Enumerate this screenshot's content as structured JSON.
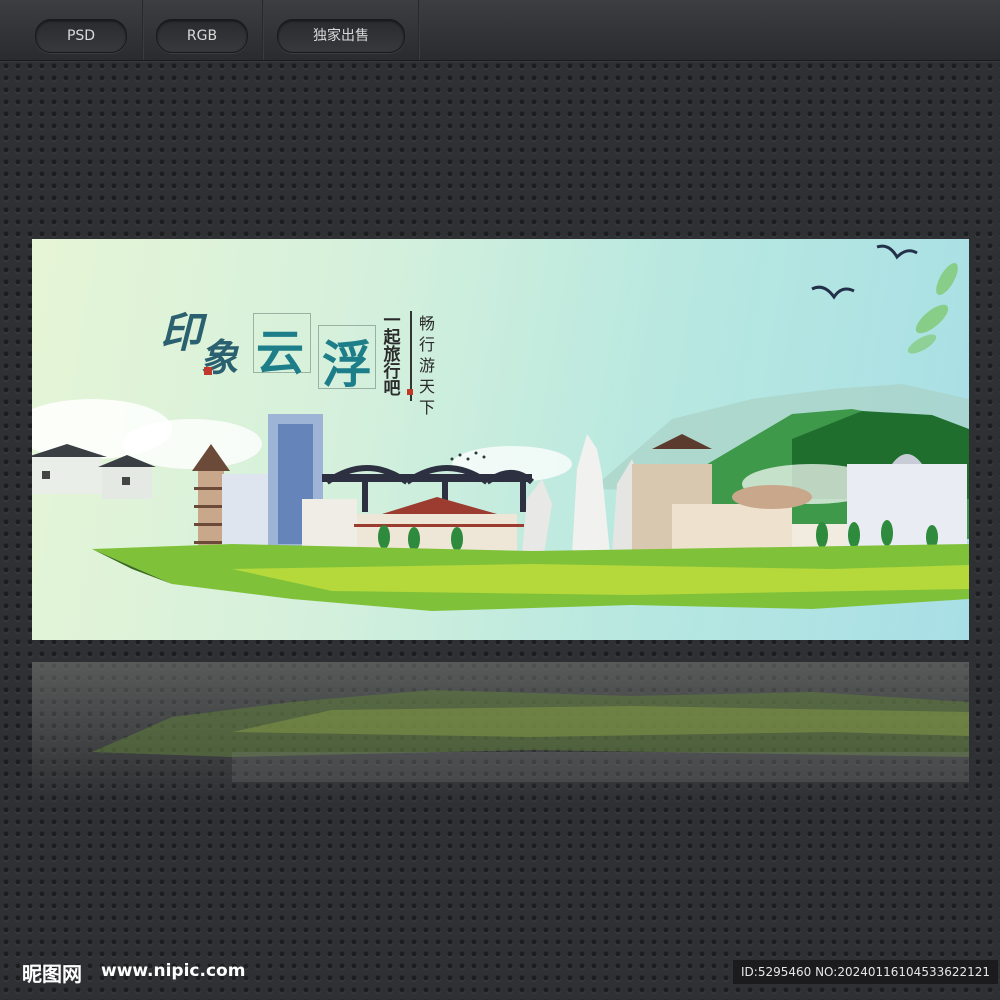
{
  "toolbar": {
    "tags": [
      "PSD",
      "RGB",
      "独家出售"
    ]
  },
  "banner": {
    "title_chars": [
      "印",
      "象",
      "云",
      "浮"
    ],
    "subtitle_chars": [
      "一",
      "起",
      "旅",
      "行",
      "吧"
    ],
    "slogan_chars": [
      "畅",
      "行",
      "游",
      "天",
      "下"
    ]
  },
  "footer": {
    "logo": "昵图网",
    "site": "www.nipic.com",
    "id_text": "ID:5295460 NO:20240116104533622121"
  },
  "colors": {
    "title": "#1d7e8a",
    "grass": "#7fc23a",
    "page_bg": "#2f3033"
  }
}
